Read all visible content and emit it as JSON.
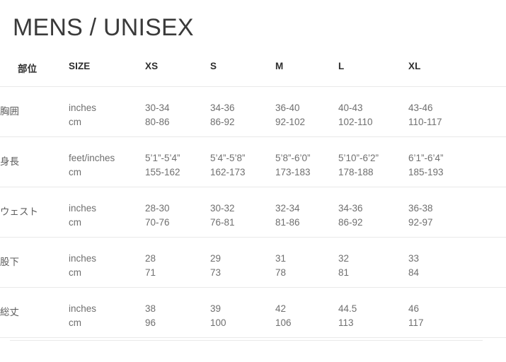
{
  "title": "MENS / UNISEX",
  "colors": {
    "background": "#ffffff",
    "title_text": "#3a3a3a",
    "header_text": "#2e2e2e",
    "body_text": "#6f6f6f",
    "row_label_text": "#5e5e5e",
    "divider": "#e9e9e9"
  },
  "table": {
    "headers": [
      "部位",
      "SIZE",
      "XS",
      "S",
      "M",
      "L",
      "XL"
    ],
    "rows": [
      {
        "part": "胸囲",
        "unit_imperial": "inches",
        "unit_metric": "cm",
        "xs_imperial": "30-34",
        "xs_metric": "80-86",
        "s_imperial": "34-36",
        "s_metric": "86-92",
        "m_imperial": "36-40",
        "m_metric": "92-102",
        "l_imperial": "40-43",
        "l_metric": "102-110",
        "xl_imperial": "43-46",
        "xl_metric": "110-117"
      },
      {
        "part": "身長",
        "unit_imperial": "feet/inches",
        "unit_metric": "cm",
        "xs_imperial": "5’1”-5’4”",
        "xs_metric": "155-162",
        "s_imperial": "5’4”-5’8”",
        "s_metric": "162-173",
        "m_imperial": "5’8”-6’0”",
        "m_metric": "173-183",
        "l_imperial": "5’10”-6’2”",
        "l_metric": "178-188",
        "xl_imperial": "6’1”-6’4”",
        "xl_metric": "185-193"
      },
      {
        "part": "ウェスト",
        "unit_imperial": "inches",
        "unit_metric": "cm",
        "xs_imperial": "28-30",
        "xs_metric": "70-76",
        "s_imperial": "30-32",
        "s_metric": "76-81",
        "m_imperial": "32-34",
        "m_metric": "81-86",
        "l_imperial": "34-36",
        "l_metric": "86-92",
        "xl_imperial": "36-38",
        "xl_metric": "92-97"
      },
      {
        "part": "股下",
        "unit_imperial": "inches",
        "unit_metric": "cm",
        "xs_imperial": "28",
        "xs_metric": "71",
        "s_imperial": "29",
        "s_metric": "73",
        "m_imperial": "31",
        "m_metric": "78",
        "l_imperial": "32",
        "l_metric": "81",
        "xl_imperial": "33",
        "xl_metric": "84"
      },
      {
        "part": "総丈",
        "unit_imperial": "inches",
        "unit_metric": "cm",
        "xs_imperial": "38",
        "xs_metric": "96",
        "s_imperial": "39",
        "s_metric": "100",
        "m_imperial": "42",
        "m_metric": "106",
        "l_imperial": "44.5",
        "l_metric": "113",
        "xl_imperial": "46",
        "xl_metric": "117"
      }
    ]
  }
}
